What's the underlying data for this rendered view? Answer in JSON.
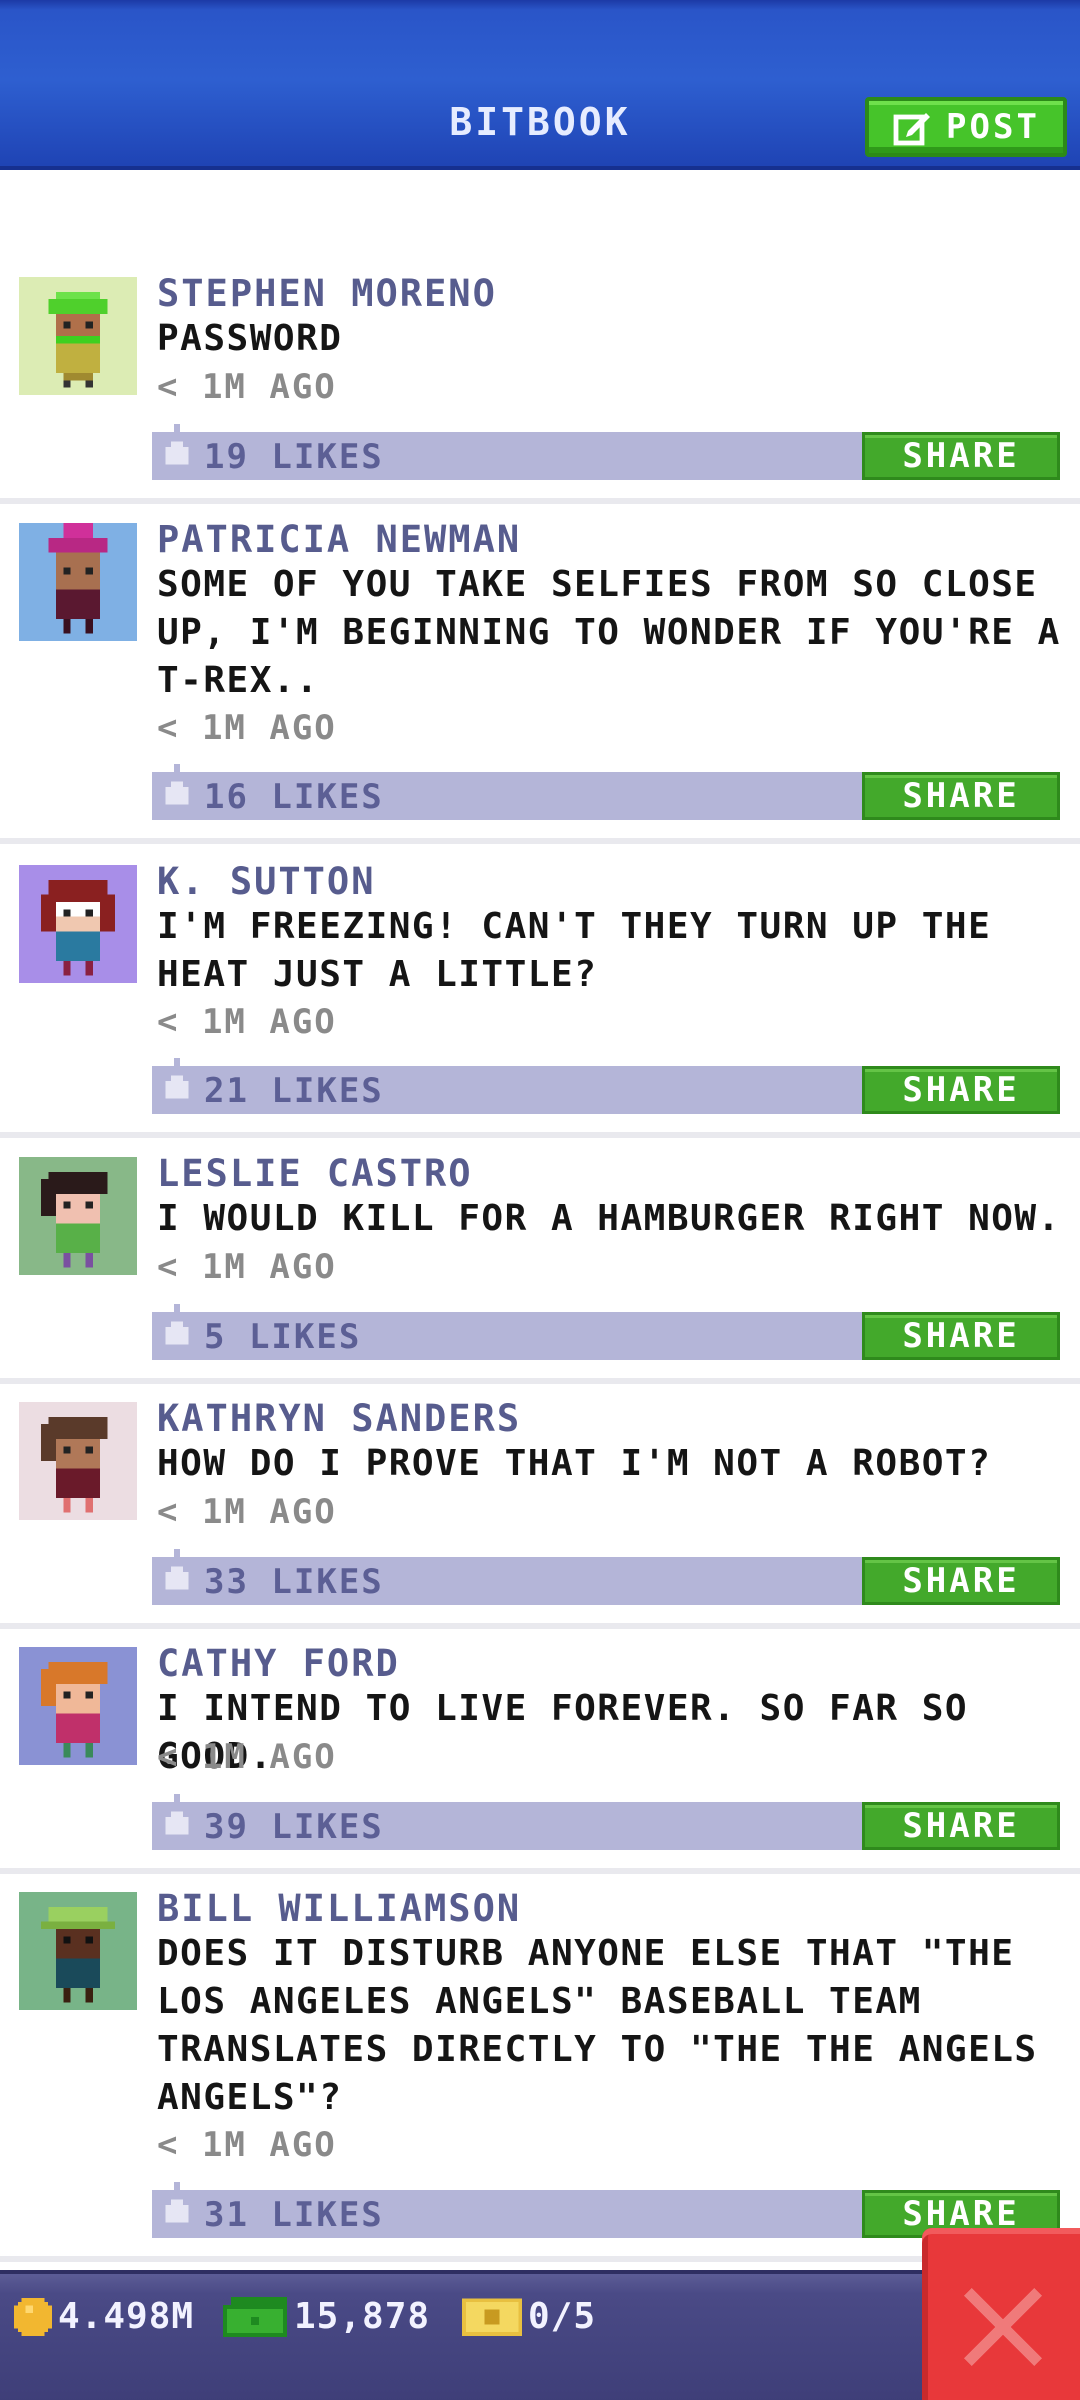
{
  "app": {
    "title": "BITBOOK",
    "post_label": "POST"
  },
  "posts": [
    {
      "author": "STEPHEN MORENO",
      "message": "PASSWORD",
      "time": "< 1M AGO",
      "likes": "19 LIKES",
      "share": "SHARE",
      "avatar_icon": "avatar-green-hair-icon"
    },
    {
      "author": "PATRICIA NEWMAN",
      "message": "SOME OF YOU TAKE SELFIES FROM SO CLOSE UP, I'M BEGINNING TO WONDER IF YOU'RE A T-REX..",
      "time": "< 1M AGO",
      "likes": "16 LIKES",
      "share": "SHARE",
      "avatar_icon": "avatar-pink-hat-icon"
    },
    {
      "author": "K. SUTTON",
      "message": "I'M FREEZING! CAN'T THEY TURN UP THE HEAT JUST A LITTLE?",
      "time": "< 1M AGO",
      "likes": "21 LIKES",
      "share": "SHARE",
      "avatar_icon": "avatar-glasses-icon"
    },
    {
      "author": "LESLIE CASTRO",
      "message": "I WOULD KILL FOR A HAMBURGER RIGHT NOW.",
      "time": "< 1M AGO",
      "likes": "5 LIKES",
      "share": "SHARE",
      "avatar_icon": "avatar-dark-hair-icon"
    },
    {
      "author": "KATHRYN SANDERS",
      "message": "HOW DO I PROVE THAT I'M NOT A ROBOT?",
      "time": "< 1M AGO",
      "likes": "33 LIKES",
      "share": "SHARE",
      "avatar_icon": "avatar-brown-hair-icon"
    },
    {
      "author": "CATHY FORD",
      "message": "I INTEND TO LIVE FOREVER. SO FAR SO GOOD.",
      "time": "< 1M AGO",
      "likes": "39 LIKES",
      "share": "SHARE",
      "avatar_icon": "avatar-orange-hair-icon"
    },
    {
      "author": "BILL WILLIAMSON",
      "message": "DOES IT DISTURB ANYONE ELSE THAT \"THE LOS ANGELES ANGELS\" BASEBALL TEAM TRANSLATES DIRECTLY TO \"THE THE ANGELS ANGELS\"?",
      "time": "< 1M AGO",
      "likes": "31 LIKES",
      "share": "SHARE",
      "avatar_icon": "avatar-green-cap-icon"
    }
  ],
  "footer": {
    "coins": "4.498M",
    "bux": "15,878",
    "tickets": "0/5"
  },
  "colors": {
    "header": "#2e5fd0",
    "accent_green": "#46c42a",
    "likes_bar": "#b4b5d8",
    "author": "#575c8e",
    "close": "#e8383a"
  }
}
